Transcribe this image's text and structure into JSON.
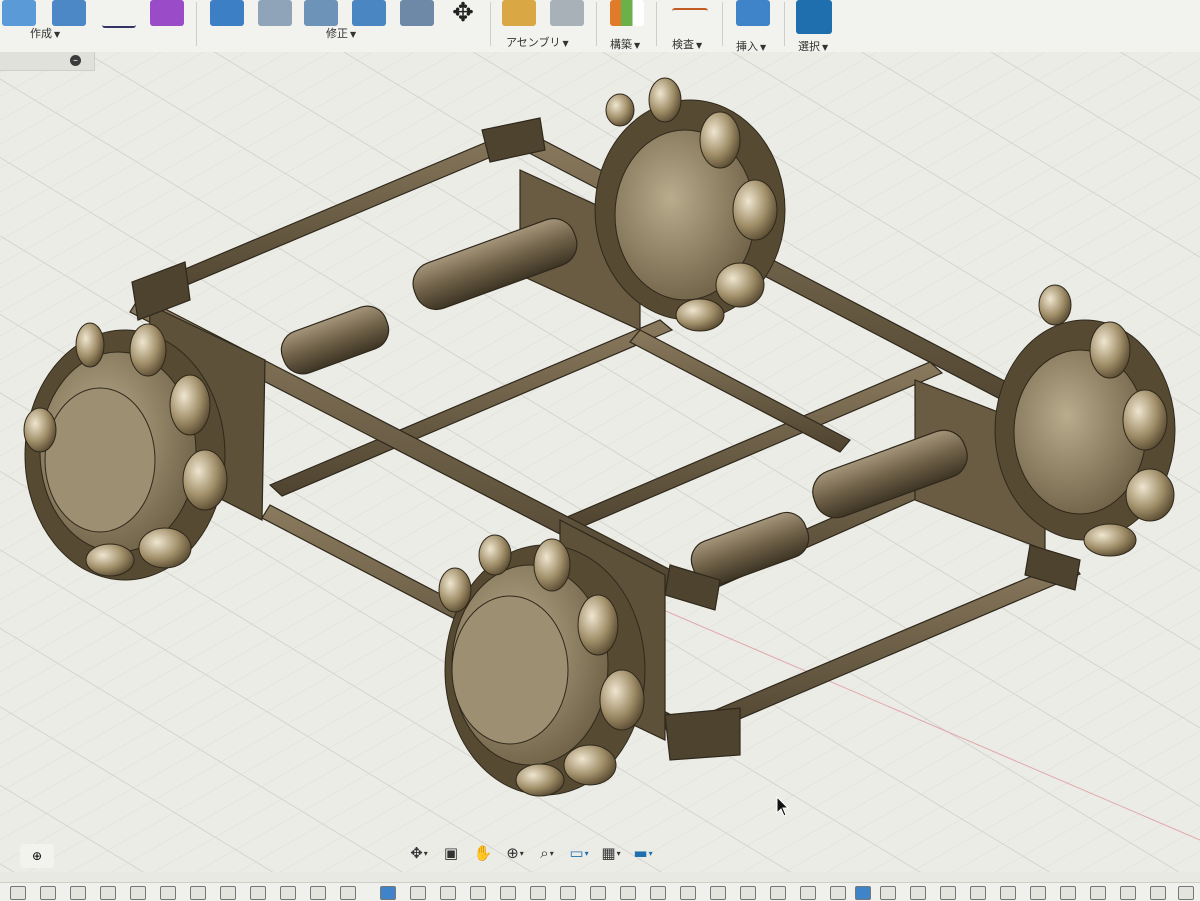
{
  "toolbar": {
    "groups": [
      {
        "id": "create",
        "label": "作成"
      },
      {
        "id": "modify",
        "label": "修正"
      },
      {
        "id": "assemble",
        "label": "アセンブリ"
      },
      {
        "id": "construct",
        "label": "構築"
      },
      {
        "id": "inspect",
        "label": "検査"
      },
      {
        "id": "insert",
        "label": "挿入"
      },
      {
        "id": "select",
        "label": "選択"
      }
    ],
    "accent": "#1e6fb8"
  },
  "browser": {
    "collapse_symbol": "–"
  },
  "viewport": {
    "background": "#ecece7",
    "grid_color": "#d6d6d0",
    "model_color": "#6b5d45",
    "model_name": "mecanum-wheel-chassis"
  },
  "navbar": {
    "icons": [
      "orbit-icon",
      "look-at-icon",
      "pan-icon",
      "zoom-icon",
      "fit-icon",
      "display-settings-icon",
      "grid-settings-icon",
      "viewports-icon"
    ]
  },
  "corner": {
    "symbol": "⊕"
  }
}
